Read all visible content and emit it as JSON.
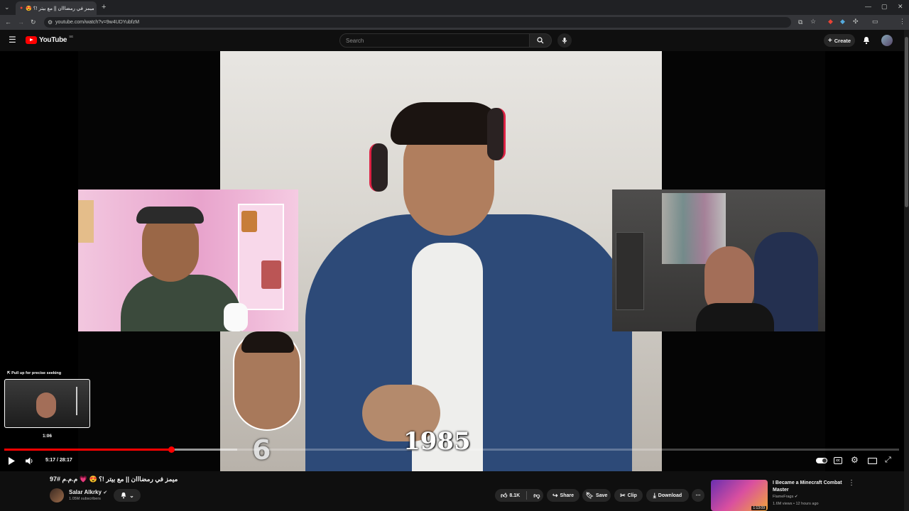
{
  "browser": {
    "tab_title": "ميمز في رمضااان || مع بيتر !؟ 😍",
    "url": "youtube.com/watch?v=9w4UDYubfzM"
  },
  "header": {
    "logo_text": "YouTube",
    "country": "SE",
    "search_placeholder": "Search",
    "create_label": "Create"
  },
  "player": {
    "seek_hint": "⇱ Pull up for precise seeking",
    "preview_time": "1:06",
    "time_display": "5:17 / 28:17",
    "progress": 0.187,
    "buffered": 0.26,
    "overlay_year": "1985",
    "overlay_number": "6"
  },
  "video": {
    "title": "ميمز في رمضااان || مع بيتر !؟ 😍 💗 م.م.م #97",
    "channel": "Salar Alkrky",
    "subscribers": "1.05M subscribers",
    "likes": "8.1K",
    "share_label": "Share",
    "save_label": "Save",
    "clip_label": "Clip",
    "download_label": "Download"
  },
  "recommended": {
    "title": "I Became a Minecraft Combat Master",
    "channel": "FlameFrags",
    "meta": "1.6M views • 12 hours ago",
    "duration": "1:13:09"
  }
}
